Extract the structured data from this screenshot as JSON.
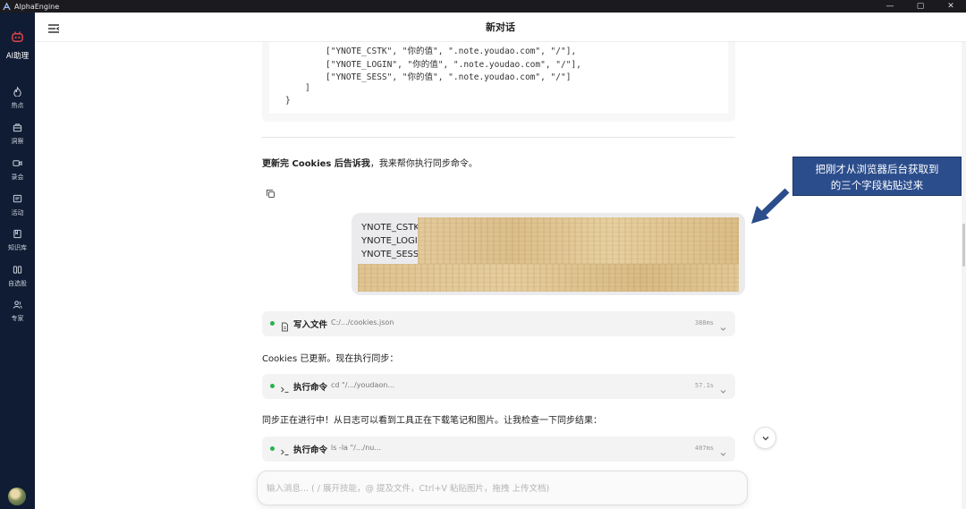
{
  "window": {
    "app_name": "AlphaEngine",
    "controls": {
      "minimize": "—",
      "maximize": "▢",
      "close": "✕"
    }
  },
  "sidebar": {
    "items": [
      {
        "label": "AI助理",
        "icon": "robot-icon",
        "active": true
      },
      {
        "label": "热点",
        "icon": "flame-icon"
      },
      {
        "label": "洞察",
        "icon": "briefcase-icon"
      },
      {
        "label": "录会",
        "icon": "video-icon"
      },
      {
        "label": "活动",
        "icon": "message-square-icon"
      },
      {
        "label": "知识库",
        "icon": "book-icon"
      },
      {
        "label": "自选股",
        "icon": "columns-icon"
      },
      {
        "label": "专家",
        "icon": "users-icon"
      }
    ]
  },
  "header": {
    "title": "新对话"
  },
  "code_block": {
    "lines": [
      "[\"YNOTE_CSTK\", \"你的值\", \".note.youdao.com\", \"/\"],",
      "[\"YNOTE_LOGIN\", \"你的值\", \".note.youdao.com\", \"/\"],",
      "[\"YNOTE_SESS\", \"你的值\", \".note.youdao.com\", \"/\"]",
      "]",
      "}"
    ]
  },
  "messages": {
    "assistant_1": {
      "bold": "更新完 Cookies 后告诉我",
      "rest": "，我来帮你执行同步命令。"
    },
    "user_1": {
      "lines": [
        "YNOTE_CSTK:",
        "YNOTE_LOGIN",
        "YNOTE_SESS:"
      ]
    },
    "assistant_2": {
      "text": "Cookies 已更新。现在执行同步："
    },
    "assistant_3": {
      "text": "同步正在进行中！从日志可以看到工具正在下载笔记和图片。让我检查一下同步结果："
    }
  },
  "tool_calls": [
    {
      "name": "写入文件",
      "arg": "C:/.../cookies.json",
      "time": "388ms",
      "icon": "file-icon",
      "status_color": "#27b34a"
    },
    {
      "name": "执行命令",
      "arg": "cd \"/.../youdaon...",
      "time": "57.1s",
      "icon": "terminal-icon",
      "status_color": "#27b34a"
    },
    {
      "name": "执行命令",
      "arg": "ls -la \"/.../nu...",
      "time": "407ms",
      "icon": "terminal-icon",
      "status_color": "#27b34a"
    }
  ],
  "annotation": {
    "lines": [
      "把刚才从浏览器后台获取到",
      "的三个字段粘贴过来"
    ],
    "color": "#2b4d8c"
  },
  "input": {
    "placeholder": "输入消息... ( / 展开技能，@ 提及文件，Ctrl+V 粘贴图片，拖拽 上传文档)"
  },
  "colors": {
    "sidebar_bg": "#101c33",
    "status_green": "#27b34a",
    "titlebar_bg": "#1b1b1f"
  }
}
